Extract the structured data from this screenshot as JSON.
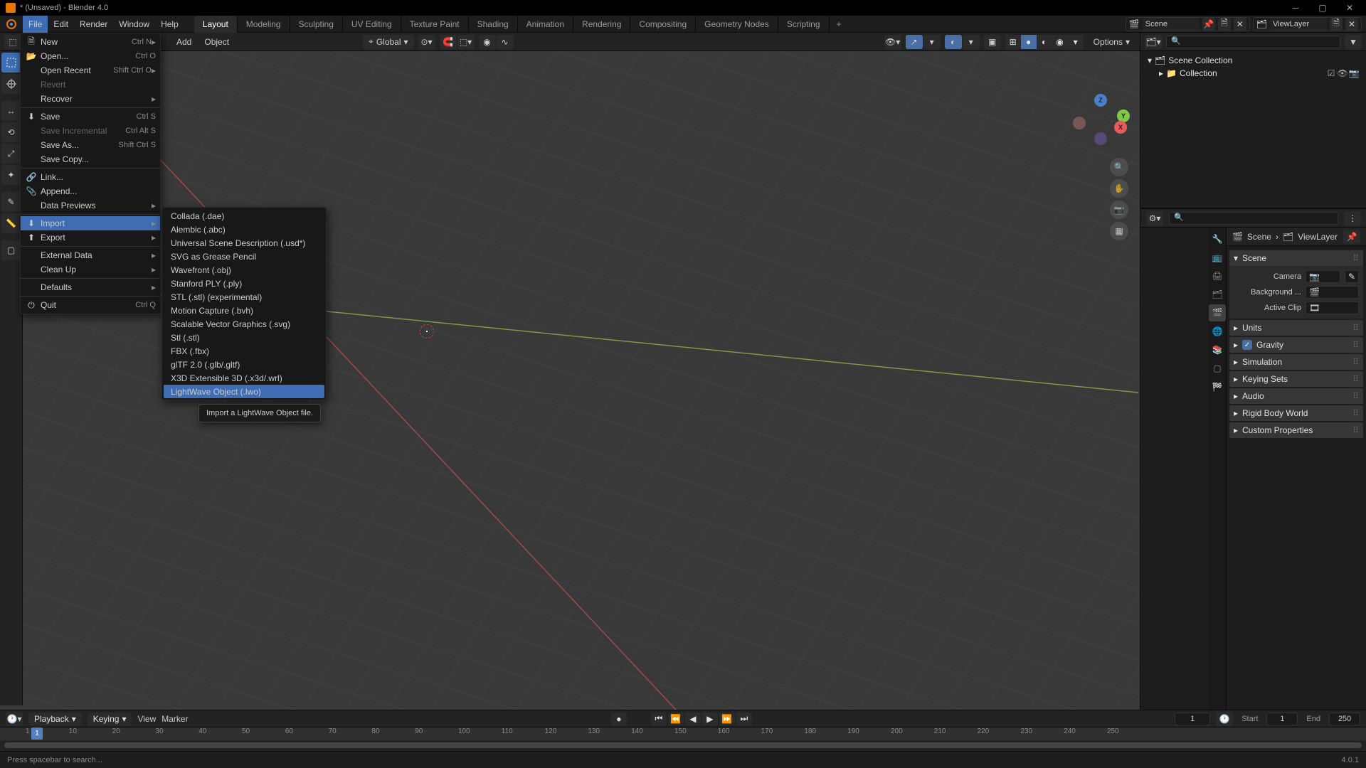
{
  "titlebar": {
    "title": "* (Unsaved) - Blender 4.0"
  },
  "menubar": {
    "items": [
      "File",
      "Edit",
      "Render",
      "Window",
      "Help"
    ],
    "active": 0
  },
  "scene_field": {
    "label": "Scene",
    "value": "Scene"
  },
  "layer_field": {
    "label": "ViewLayer",
    "value": "ViewLayer"
  },
  "workspaces": {
    "tabs": [
      "Layout",
      "Modeling",
      "Sculpting",
      "UV Editing",
      "Texture Paint",
      "Shading",
      "Animation",
      "Rendering",
      "Compositing",
      "Geometry Nodes",
      "Scripting"
    ],
    "active": 0
  },
  "viewport_header": {
    "menus": [
      "Add",
      "Object"
    ],
    "orientation": "Global",
    "options_label": "Options"
  },
  "file_menu": {
    "groups": [
      [
        {
          "label": "New",
          "shortcut": "Ctrl N",
          "icon": "file",
          "sub": true
        },
        {
          "label": "Open...",
          "shortcut": "Ctrl O",
          "icon": "folder"
        },
        {
          "label": "Open Recent",
          "shortcut": "Shift Ctrl O",
          "sub": true
        },
        {
          "label": "Revert",
          "disabled": true
        },
        {
          "label": "Recover",
          "sub": true
        }
      ],
      [
        {
          "label": "Save",
          "shortcut": "Ctrl S",
          "icon": "save"
        },
        {
          "label": "Save Incremental",
          "shortcut": "Ctrl Alt S",
          "disabled": true
        },
        {
          "label": "Save As...",
          "shortcut": "Shift Ctrl S"
        },
        {
          "label": "Save Copy..."
        }
      ],
      [
        {
          "label": "Link...",
          "icon": "link"
        },
        {
          "label": "Append...",
          "icon": "append"
        },
        {
          "label": "Data Previews",
          "sub": true
        }
      ],
      [
        {
          "label": "Import",
          "icon": "import",
          "sub": true,
          "highlighted": true
        },
        {
          "label": "Export",
          "icon": "export",
          "sub": true
        }
      ],
      [
        {
          "label": "External Data",
          "sub": true
        },
        {
          "label": "Clean Up",
          "sub": true
        }
      ],
      [
        {
          "label": "Defaults",
          "sub": true
        }
      ],
      [
        {
          "label": "Quit",
          "shortcut": "Ctrl Q",
          "icon": "quit"
        }
      ]
    ]
  },
  "import_submenu": {
    "items": [
      "Collada (.dae)",
      "Alembic (.abc)",
      "Universal Scene Description (.usd*)",
      "SVG as Grease Pencil",
      "Wavefront (.obj)",
      "Stanford PLY (.ply)",
      "STL (.stl) (experimental)",
      "Motion Capture (.bvh)",
      "Scalable Vector Graphics (.svg)",
      "Stl (.stl)",
      "FBX (.fbx)",
      "glTF 2.0 (.glb/.gltf)",
      "X3D Extensible 3D (.x3d/.wrl)",
      "LightWave Object (.lwo)"
    ],
    "highlighted": 13
  },
  "tooltip": {
    "text": "Import a LightWave Object file."
  },
  "outliner": {
    "root": "Scene Collection",
    "items": [
      "Collection"
    ]
  },
  "properties": {
    "breadcrumb": [
      "Scene",
      "ViewLayer"
    ],
    "scene_panel": {
      "title": "Scene",
      "camera_label": "Camera",
      "background_label": "Background ...",
      "active_clip_label": "Active Clip"
    },
    "panels": [
      "Units",
      "Gravity",
      "Simulation",
      "Keying Sets",
      "Audio",
      "Rigid Body World",
      "Custom Properties"
    ],
    "gravity_checked": true
  },
  "timeline": {
    "menus": [
      "Playback",
      "Keying",
      "View",
      "Marker"
    ],
    "current": 1,
    "start_label": "Start",
    "start": 1,
    "end_label": "End",
    "end": 250,
    "ruler_ticks": [
      1,
      10,
      20,
      30,
      40,
      50,
      60,
      70,
      80,
      90,
      100,
      110,
      120,
      130,
      140,
      150,
      160,
      170,
      180,
      190,
      200,
      210,
      220,
      230,
      240,
      250
    ]
  },
  "statusbar": {
    "hint": "Press spacebar to search...",
    "version": "4.0.1"
  },
  "gizmo": {
    "x": "X",
    "y": "Y",
    "z": "Z"
  }
}
